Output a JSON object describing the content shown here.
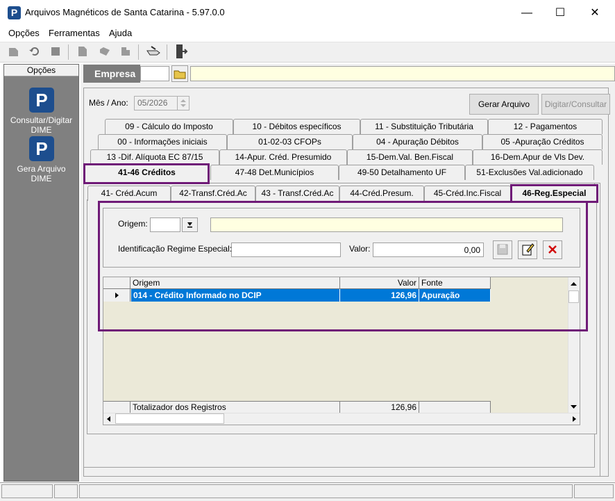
{
  "window": {
    "title": "Arquivos Magnéticos de Santa Catarina - 5.97.0.0",
    "app_icon_letter": "P",
    "minimize": "—",
    "maximize": "☐",
    "close": "✕"
  },
  "menu": [
    "Opções",
    "Ferramentas",
    "Ajuda"
  ],
  "sidebar": {
    "header": "Opções",
    "items": [
      {
        "icon_letter": "P",
        "label_line1": "Consultar/Digitar",
        "label_line2": "DIME"
      },
      {
        "icon_letter": "P",
        "label_line1": "Gera Arquivo",
        "label_line2": "DIME"
      }
    ]
  },
  "empresa": {
    "label": "Empresa",
    "code": "",
    "name": ""
  },
  "periodo": {
    "label": "Mês / Ano:",
    "value": "05/2026"
  },
  "buttons": {
    "gerar": "Gerar Arquivo",
    "digitar": "Digitar/Consultar"
  },
  "tabs_row1": [
    "09 - Cálculo do Imposto",
    "10 - Débitos específicos",
    "11 - Substituição Tributária",
    "12 - Pagamentos"
  ],
  "tabs_row2": [
    "00 - Informações iniciais",
    "01-02-03  CFOPs",
    "04 - Apuração Débitos",
    "05 -Apuração Créditos"
  ],
  "tabs_row3": [
    "13 -Dif. Alíquota EC 87/15",
    "14-Apur. Créd. Presumido",
    "15-Dem.Val. Ben.Fiscal",
    "16-Dem.Apur de Vls Dev."
  ],
  "tabs_row4": [
    "41-46  Créditos",
    "47-48  Det.Municípios",
    "49-50  Detalhamento UF",
    "51-Exclusões Val.adicionado"
  ],
  "subtabs": [
    "41- Créd.Acum",
    "42-Transf.Créd.Ac",
    "43 - Transf.Créd.Ac",
    "44-Créd.Presum.",
    "45-Créd.Inc.Fiscal",
    "46-Reg.Especial"
  ],
  "form": {
    "origem_label": "Origem:",
    "origem_value": "",
    "origem_desc": "",
    "ident_label": "Identificação Regime Especial:",
    "ident_value": "",
    "valor_label": "Valor:",
    "valor_value": "0,00"
  },
  "grid": {
    "headers": [
      "Origem",
      "Valor",
      "Fonte"
    ],
    "rows": [
      {
        "origem": "014 - Crédito Informado no DCIP",
        "valor": "126,96",
        "fonte": "Apuração"
      }
    ],
    "footer_label": "Totalizador dos Registros",
    "footer_value": "126,96"
  }
}
